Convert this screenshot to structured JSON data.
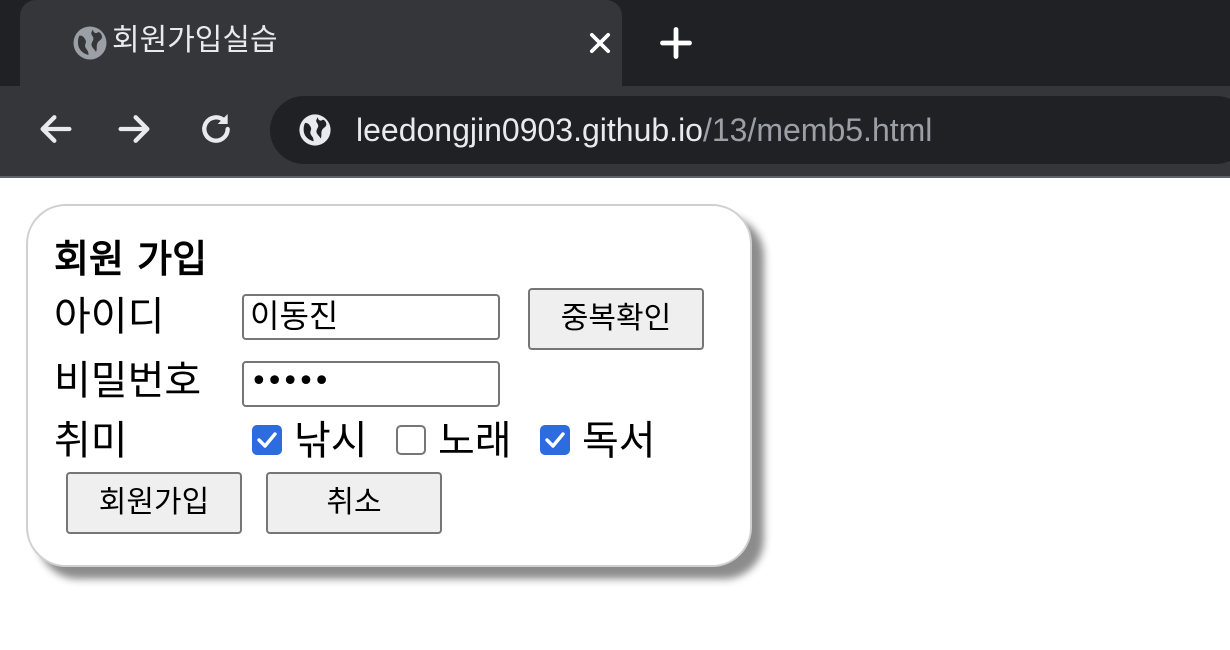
{
  "browser": {
    "tab_title": "회원가입실습",
    "url_host": "leedongjin0903.github.io",
    "url_path": "/13/memb5.html",
    "icons": {
      "tab": "globe-icon",
      "close": "close-icon",
      "new_tab": "plus-icon",
      "back": "arrow-left-icon",
      "forward": "arrow-right-icon",
      "reload": "reload-icon",
      "site_info": "globe-icon"
    }
  },
  "form": {
    "heading": "회원 가입",
    "id_label": "아이디",
    "id_value": "이동진",
    "check_button": "중복확인",
    "password_label": "비밀번호",
    "password_masked": "•••••",
    "hobby_label": "취미",
    "hobbies": [
      {
        "label": "낚시",
        "checked": true
      },
      {
        "label": "노래",
        "checked": false
      },
      {
        "label": "독서",
        "checked": true
      }
    ],
    "submit_button": "회원가입",
    "cancel_button": "취소"
  },
  "colors": {
    "checkbox_accent": "#2d6cdf",
    "chrome_dark": "#202124",
    "chrome_tab": "#35363a"
  }
}
